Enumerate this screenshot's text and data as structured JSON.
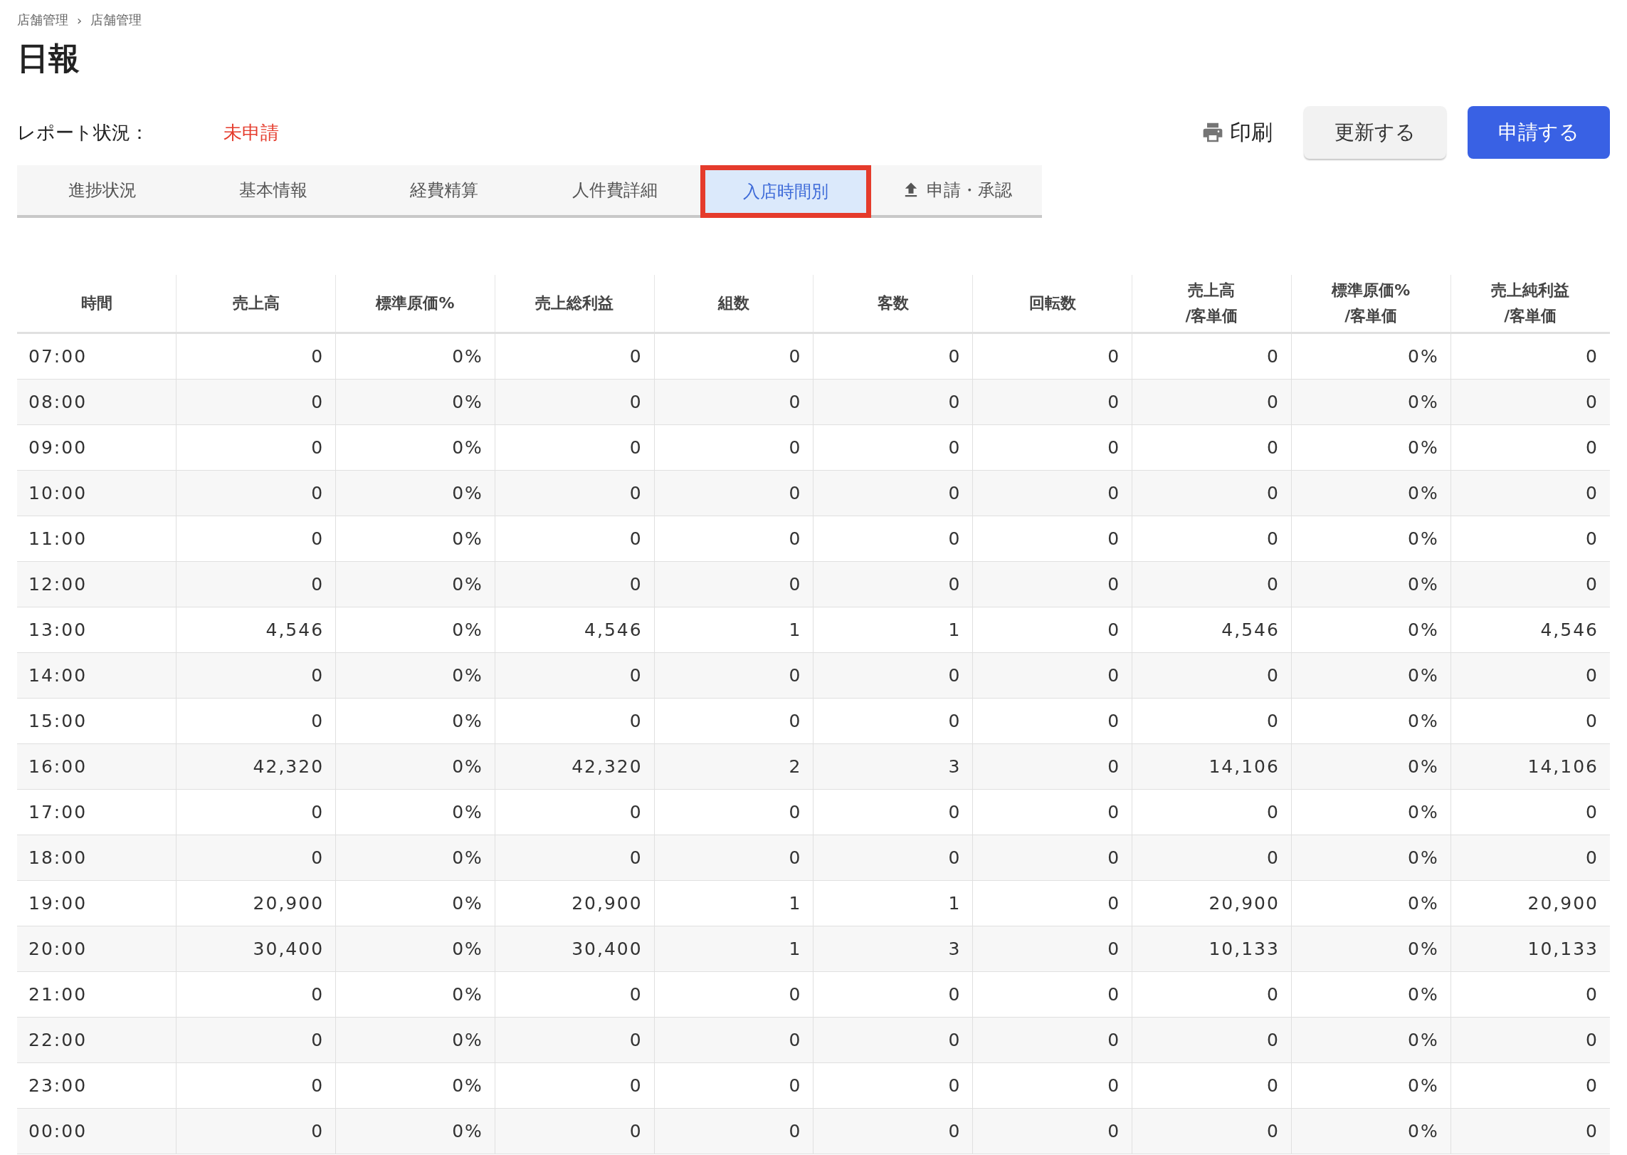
{
  "breadcrumb": [
    "店舗管理",
    "店舗管理"
  ],
  "breadcrumb_separator": "›",
  "title": "日報",
  "report_status": {
    "label": "レポート状況：",
    "value": "未申請"
  },
  "actions": {
    "print": "印刷",
    "update": "更新する",
    "submit": "申請する"
  },
  "tabs": [
    {
      "label": "進捗状況",
      "selected": false
    },
    {
      "label": "基本情報",
      "selected": false
    },
    {
      "label": "経費精算",
      "selected": false
    },
    {
      "label": "人件費詳細",
      "selected": false
    },
    {
      "label": "入店時間別",
      "selected": true
    },
    {
      "label": "申請・承認",
      "selected": false,
      "kind": "upload"
    }
  ],
  "table": {
    "columns": [
      "時間",
      "売上高",
      "標準原価%",
      "売上総利益",
      "組数",
      "客数",
      "回転数",
      "売上高\n/客単価",
      "標準原価%\n/客単価",
      "売上純利益\n/客単価"
    ],
    "rows": [
      [
        "07:00",
        "0",
        "0%",
        "0",
        "0",
        "0",
        "0",
        "0",
        "0%",
        "0"
      ],
      [
        "08:00",
        "0",
        "0%",
        "0",
        "0",
        "0",
        "0",
        "0",
        "0%",
        "0"
      ],
      [
        "09:00",
        "0",
        "0%",
        "0",
        "0",
        "0",
        "0",
        "0",
        "0%",
        "0"
      ],
      [
        "10:00",
        "0",
        "0%",
        "0",
        "0",
        "0",
        "0",
        "0",
        "0%",
        "0"
      ],
      [
        "11:00",
        "0",
        "0%",
        "0",
        "0",
        "0",
        "0",
        "0",
        "0%",
        "0"
      ],
      [
        "12:00",
        "0",
        "0%",
        "0",
        "0",
        "0",
        "0",
        "0",
        "0%",
        "0"
      ],
      [
        "13:00",
        "4,546",
        "0%",
        "4,546",
        "1",
        "1",
        "0",
        "4,546",
        "0%",
        "4,546"
      ],
      [
        "14:00",
        "0",
        "0%",
        "0",
        "0",
        "0",
        "0",
        "0",
        "0%",
        "0"
      ],
      [
        "15:00",
        "0",
        "0%",
        "0",
        "0",
        "0",
        "0",
        "0",
        "0%",
        "0"
      ],
      [
        "16:00",
        "42,320",
        "0%",
        "42,320",
        "2",
        "3",
        "0",
        "14,106",
        "0%",
        "14,106"
      ],
      [
        "17:00",
        "0",
        "0%",
        "0",
        "0",
        "0",
        "0",
        "0",
        "0%",
        "0"
      ],
      [
        "18:00",
        "0",
        "0%",
        "0",
        "0",
        "0",
        "0",
        "0",
        "0%",
        "0"
      ],
      [
        "19:00",
        "20,900",
        "0%",
        "20,900",
        "1",
        "1",
        "0",
        "20,900",
        "0%",
        "20,900"
      ],
      [
        "20:00",
        "30,400",
        "0%",
        "30,400",
        "1",
        "3",
        "0",
        "10,133",
        "0%",
        "10,133"
      ],
      [
        "21:00",
        "0",
        "0%",
        "0",
        "0",
        "0",
        "0",
        "0",
        "0%",
        "0"
      ],
      [
        "22:00",
        "0",
        "0%",
        "0",
        "0",
        "0",
        "0",
        "0",
        "0%",
        "0"
      ],
      [
        "23:00",
        "0",
        "0%",
        "0",
        "0",
        "0",
        "0",
        "0",
        "0%",
        "0"
      ],
      [
        "00:00",
        "0",
        "0%",
        "0",
        "0",
        "0",
        "0",
        "0",
        "0%",
        "0"
      ]
    ]
  }
}
